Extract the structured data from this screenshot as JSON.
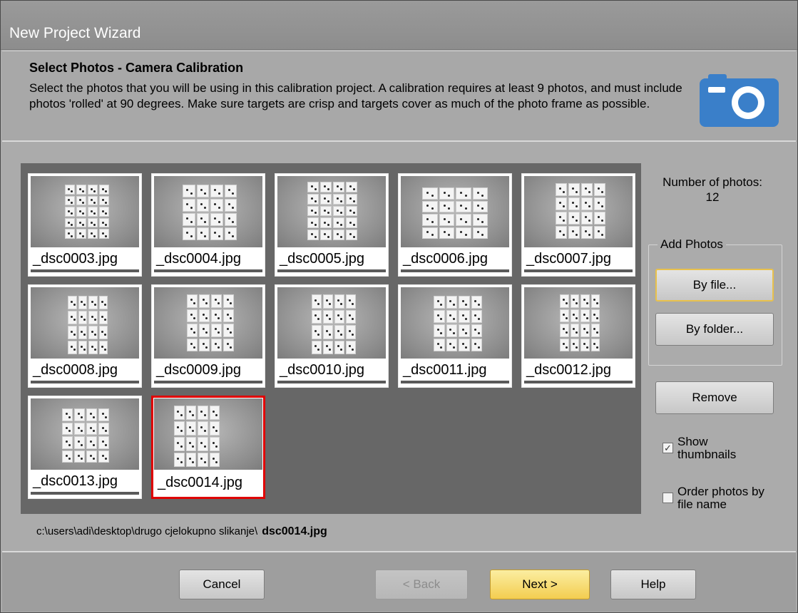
{
  "window": {
    "title": "New Project Wizard"
  },
  "header": {
    "heading": "Select Photos - Camera Calibration",
    "description": "Select the photos that you will be using in this calibration project. A calibration requires at least 9 photos, and must include photos 'rolled' at 90 degrees. Make sure targets are crisp and targets cover as much of the photo frame as possible.",
    "icon": "camera-icon",
    "icon_color": "#3a7fc9"
  },
  "gallery": {
    "photos": [
      {
        "name": "_dsc0003.jpg",
        "selected": false
      },
      {
        "name": "_dsc0004.jpg",
        "selected": false
      },
      {
        "name": "_dsc0005.jpg",
        "selected": false
      },
      {
        "name": "_dsc0006.jpg",
        "selected": false
      },
      {
        "name": "_dsc0007.jpg",
        "selected": false
      },
      {
        "name": "_dsc0008.jpg",
        "selected": false
      },
      {
        "name": "_dsc0009.jpg",
        "selected": false
      },
      {
        "name": "_dsc0010.jpg",
        "selected": false
      },
      {
        "name": "_dsc0011.jpg",
        "selected": false
      },
      {
        "name": "_dsc0012.jpg",
        "selected": false
      },
      {
        "name": "_dsc0013.jpg",
        "selected": false
      },
      {
        "name": "_dsc0014.jpg",
        "selected": true
      }
    ],
    "selection_color": "#e00000"
  },
  "side": {
    "count_label": "Number of photos: 12",
    "add_photos_label": "Add Photos",
    "by_file": "By file...",
    "by_folder": "By folder...",
    "remove": "Remove",
    "show_thumbnails": {
      "label": "Show thumbnails",
      "checked": true
    },
    "order_by_name": {
      "label": "Order photos by file name",
      "checked": false
    }
  },
  "status": {
    "path": "c:\\users\\adi\\desktop\\drugo cjelokupno slikanje\\",
    "file": "dsc0014.jpg"
  },
  "footer": {
    "cancel": "Cancel",
    "back": "< Back",
    "next": "Next >",
    "help": "Help"
  }
}
